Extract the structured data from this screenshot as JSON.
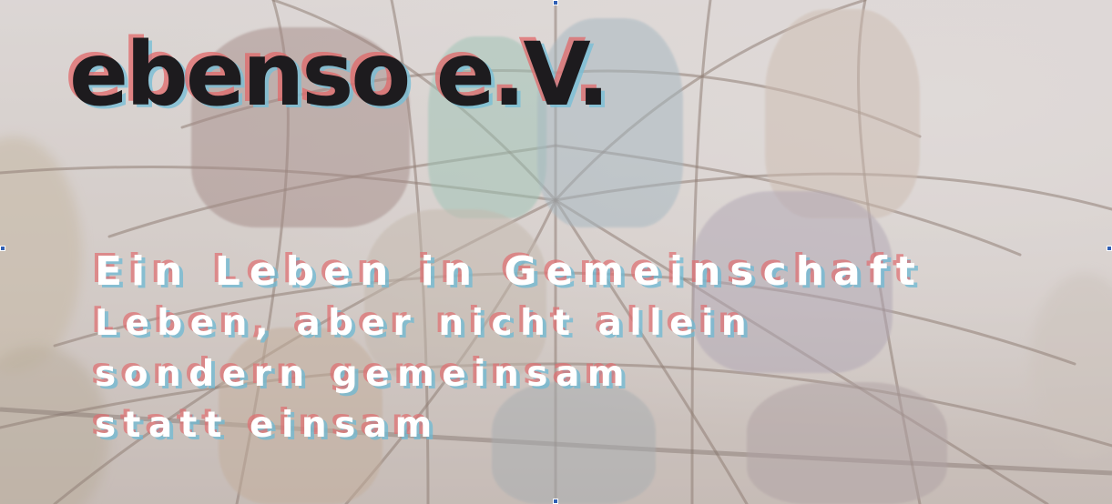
{
  "hero": {
    "title": "ebenso e.V.",
    "taglines": [
      "Ein Leben in Gemeinschaft",
      "Leben, aber nicht allein",
      "sondern gemeinsam",
      "statt einsam"
    ],
    "background": "photo-group-on-rope-climbing-net"
  },
  "colors": {
    "title_text": "#1d1b1e",
    "tagline_text": "#ffffff",
    "shadow_red": "#e0686a",
    "shadow_cyan": "#78bed6",
    "selection_handle": "#2f5fb4"
  }
}
